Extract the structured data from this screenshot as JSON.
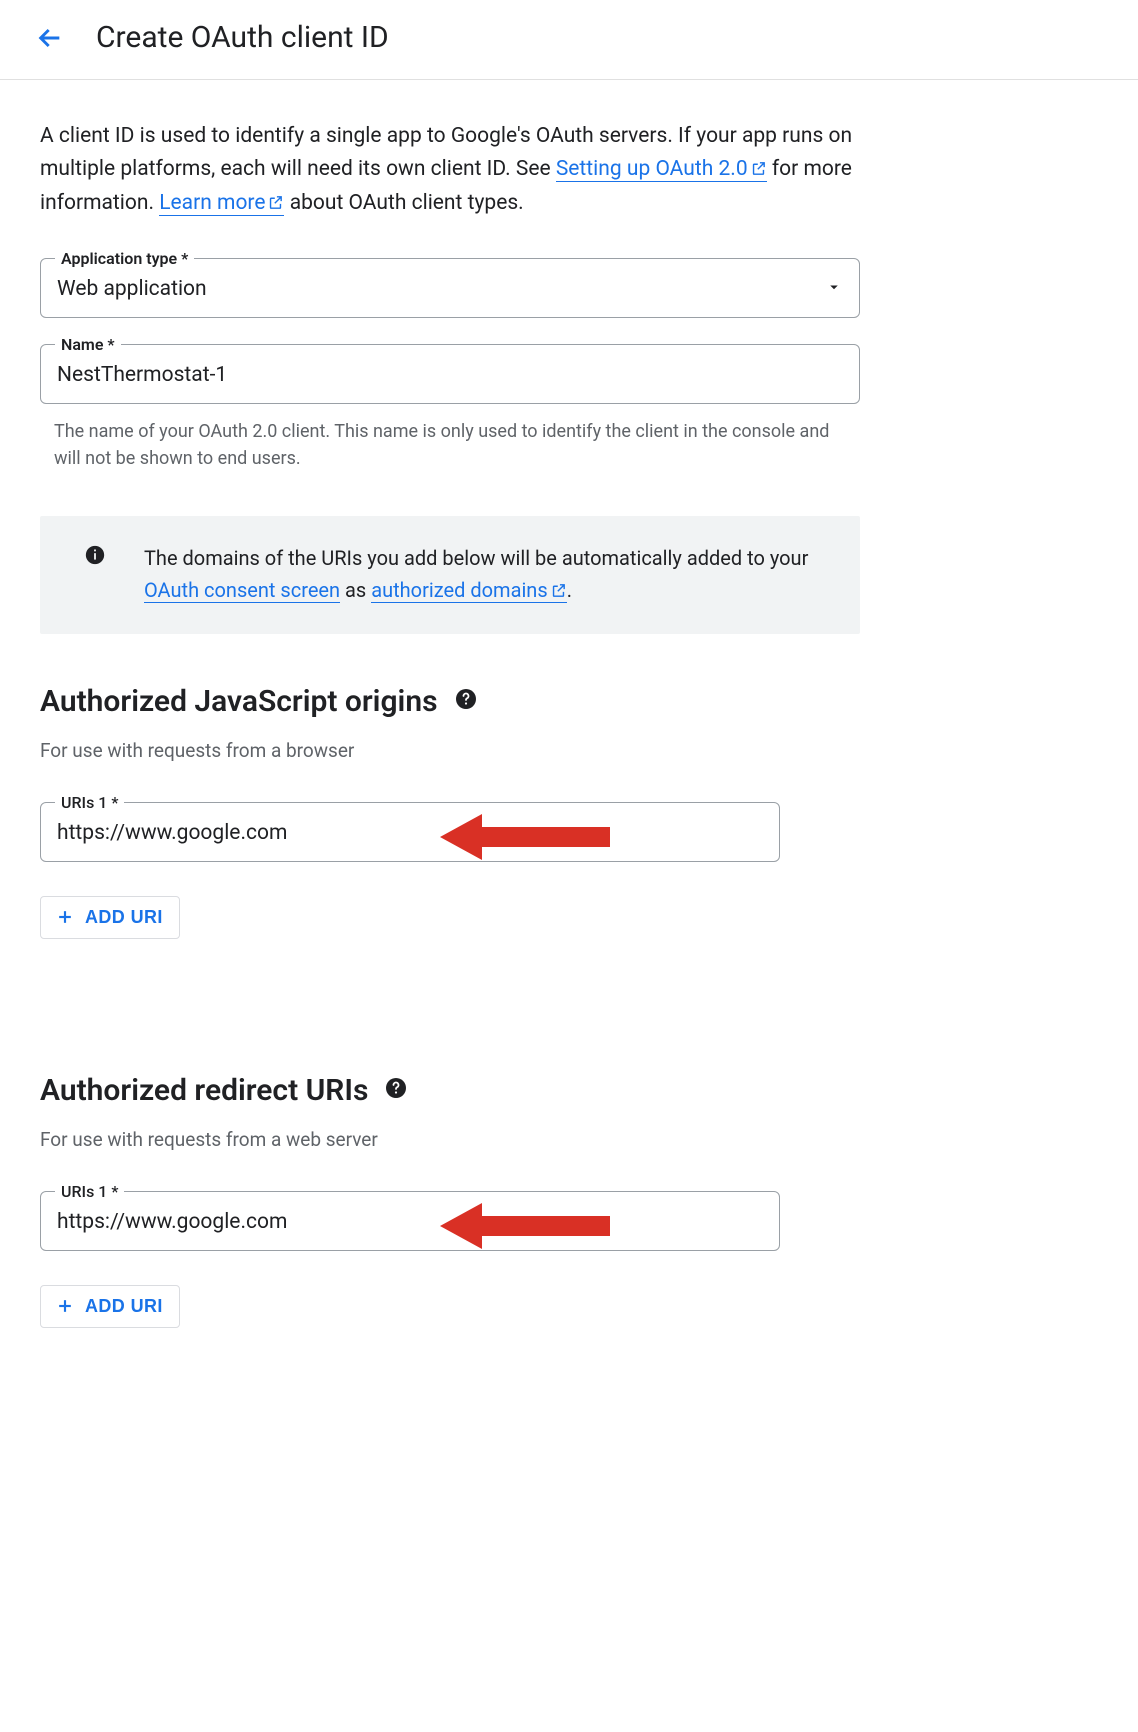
{
  "header": {
    "title": "Create OAuth client ID"
  },
  "intro": {
    "text_before_link1": "A client ID is used to identify a single app to Google's OAuth servers. If your app runs on multiple platforms, each will need its own client ID. See ",
    "link1": "Setting up OAuth 2.0",
    "text_between": " for more information. ",
    "link2": "Learn more",
    "text_after": " about OAuth client types."
  },
  "app_type": {
    "label": "Application type *",
    "value": "Web application"
  },
  "name": {
    "label": "Name *",
    "value": "NestThermostat-1",
    "helper": "The name of your OAuth 2.0 client. This name is only used to identify the client in the console and will not be shown to end users."
  },
  "banner": {
    "text_before": "The domains of the URIs you add below will be automatically added to your ",
    "link1": "OAuth consent screen",
    "text_mid": " as ",
    "link2": "authorized domains",
    "text_after": "."
  },
  "js_origins": {
    "title": "Authorized JavaScript origins",
    "subtitle": "For use with requests from a browser",
    "uri_label": "URIs 1 *",
    "uri_value": "https://www.google.com",
    "add_label": "ADD URI"
  },
  "redirect": {
    "title": "Authorized redirect URIs",
    "subtitle": "For use with requests from a web server",
    "uri_label": "URIs 1 *",
    "uri_value": "https://www.google.com",
    "add_label": "ADD URI"
  }
}
